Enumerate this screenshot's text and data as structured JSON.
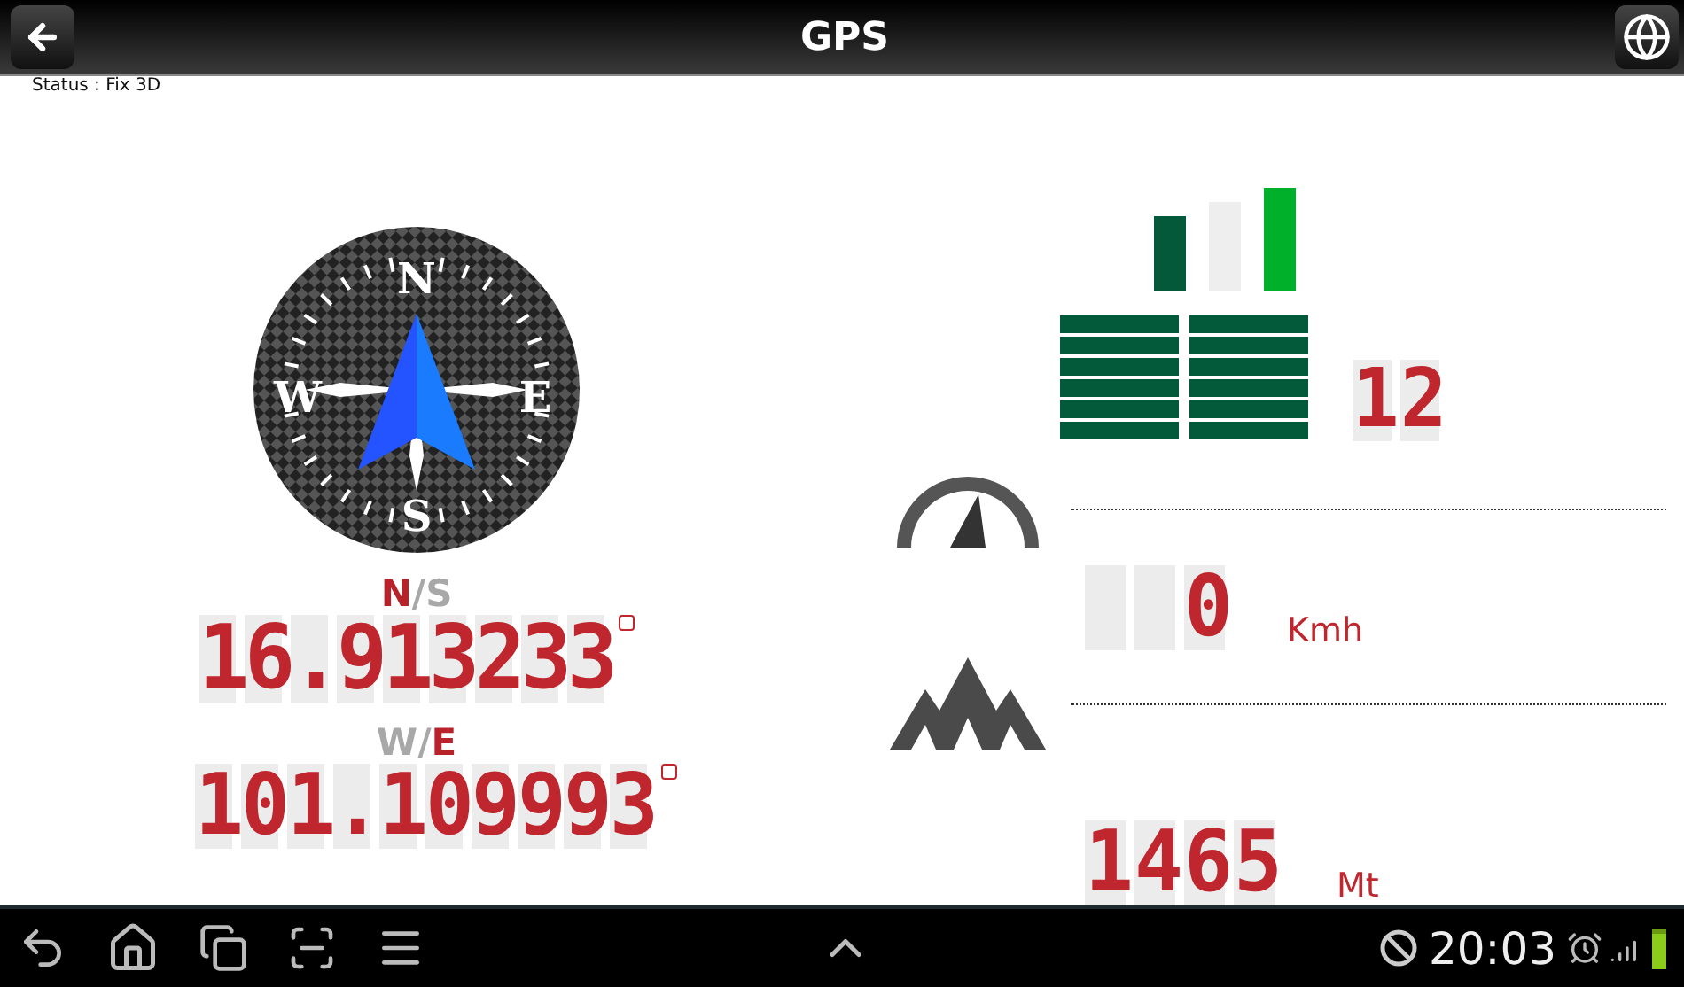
{
  "header": {
    "title": "GPS"
  },
  "status": "Status : Fix 3D",
  "compass": {
    "labels": [
      {
        "text": "N",
        "kind": "north"
      },
      {
        "text": "E",
        "kind": "east"
      },
      {
        "text": "S",
        "kind": "south"
      },
      {
        "text": "W",
        "kind": "west"
      }
    ]
  },
  "latitude": {
    "hemisphere": [
      {
        "text": "N",
        "selected": true
      },
      {
        "text": "/",
        "selected": false
      },
      {
        "text": "S",
        "selected": false
      }
    ],
    "value": "16.913233"
  },
  "longitude": {
    "hemisphere": [
      {
        "text": "W",
        "selected": false
      },
      {
        "text": "/",
        "selected": false
      },
      {
        "text": "E",
        "selected": true
      }
    ],
    "value": "101.109993"
  },
  "signal_bars": [
    {
      "color": "#03593a"
    },
    {
      "color": "#eeeeee"
    },
    {
      "color": "#00af2a"
    }
  ],
  "satellites": {
    "value": "12"
  },
  "speed": {
    "value": "0",
    "unit": "Kmh"
  },
  "altitude": {
    "value": "1465",
    "unit": "Mt"
  },
  "system_bar": {
    "time": "20:03"
  }
}
